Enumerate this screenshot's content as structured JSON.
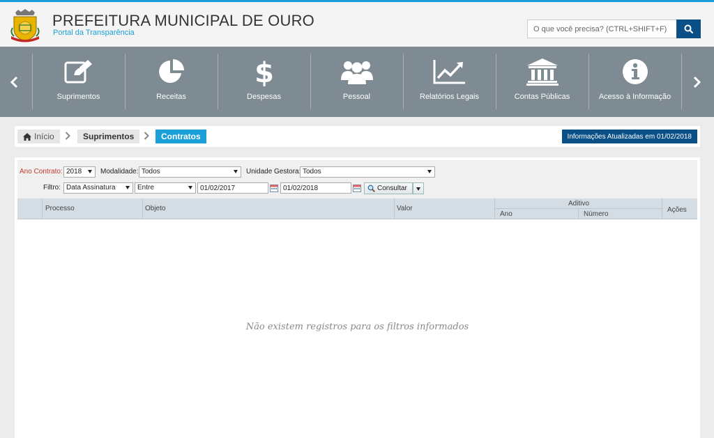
{
  "header": {
    "title": "PREFEITURA MUNICIPAL DE OURO",
    "subtitle": "Portal da Transparência",
    "search_placeholder": "O que você precisa? (CTRL+SHIFT+F)"
  },
  "nav": {
    "items": [
      {
        "label": "Suprimentos",
        "icon": "edit-icon"
      },
      {
        "label": "Receitas",
        "icon": "pie-chart-icon"
      },
      {
        "label": "Despesas",
        "icon": "dollar-icon"
      },
      {
        "label": "Pessoal",
        "icon": "users-icon"
      },
      {
        "label": "Relatórios Legais",
        "icon": "line-chart-icon"
      },
      {
        "label": "Contas Públicas",
        "icon": "bank-icon"
      },
      {
        "label": "Acesso à Informação",
        "icon": "info-icon"
      }
    ]
  },
  "breadcrumb": {
    "home": "Início",
    "level1": "Suprimentos",
    "current": "Contratos",
    "updated": "Informações Atualizadas em 01/02/2018"
  },
  "filters": {
    "ano_label": "Ano Contrato:",
    "ano_value": "2018",
    "modalidade_label": "Modalidade:",
    "modalidade_value": "Todos",
    "unidade_label": "Unidade Gestora:",
    "unidade_value": "Todos",
    "filtro_label": "Filtro:",
    "filtro_value": "Data Assinatura",
    "operador_value": "Entre",
    "data_inicio": "01/02/2017",
    "data_fim": "01/02/2018",
    "consultar_label": "Consultar"
  },
  "table": {
    "columns": {
      "processo": "Processo",
      "objeto": "Objeto",
      "valor": "Valor",
      "aditivo": "Aditivo",
      "ano": "Ano",
      "numero": "Número",
      "acoes": "Ações"
    },
    "empty_message": "Não existem registros para os filtros informados"
  },
  "colors": {
    "accent": "#1a9fd8",
    "dark_blue": "#0b4f87",
    "nav_bg": "#7e8b92"
  }
}
